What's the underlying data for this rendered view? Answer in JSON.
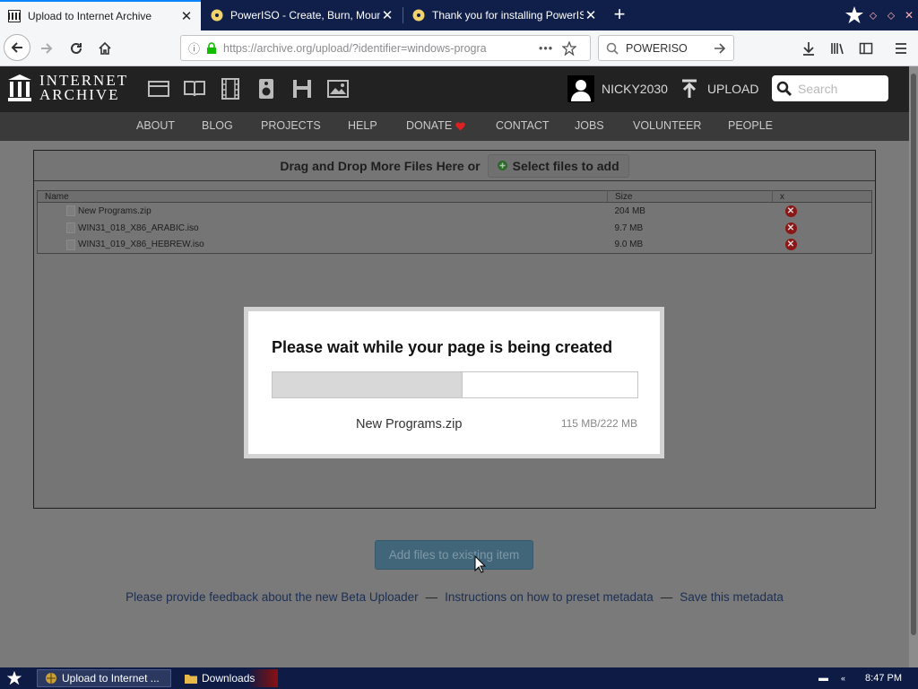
{
  "browser": {
    "tabs": [
      {
        "title": "Upload to Internet Archive",
        "active": true
      },
      {
        "title": "PowerISO - Create, Burn, Mount,",
        "active": false
      },
      {
        "title": "Thank you for installing PowerISO!",
        "active": false
      }
    ],
    "url": "https://archive.org/upload/?identifier=windows-progra",
    "search_value": "POWERISO"
  },
  "site": {
    "logo_line1": "INTERNET",
    "logo_line2": "ARCHIVE",
    "username": "NICKY2030",
    "upload_label": "UPLOAD",
    "search_placeholder": "Search",
    "nav": [
      "ABOUT",
      "BLOG",
      "PROJECTS",
      "HELP",
      "DONATE",
      "CONTACT",
      "JOBS",
      "VOLUNTEER",
      "PEOPLE"
    ]
  },
  "uploader": {
    "dropzone_text": "Drag and Drop More Files Here or",
    "select_label": "Select files to add",
    "columns": {
      "name": "Name",
      "size": "Size",
      "remove": "x"
    },
    "files": [
      {
        "name": "New Programs.zip",
        "size": "204 MB"
      },
      {
        "name": "WIN31_018_X86_ARABIC.iso",
        "size": "9.7 MB"
      },
      {
        "name": "WIN31_019_X86_HEBREW.iso",
        "size": "9.0 MB"
      }
    ],
    "add_button": "Add files to existing item"
  },
  "footer": {
    "feedback": "Please provide feedback about the new Beta Uploader",
    "instructions": "Instructions on how to preset metadata",
    "save": "Save this metadata",
    "separator": "—"
  },
  "modal": {
    "title": "Please wait while your page is being created",
    "filename": "New Programs.zip",
    "size_text": "115 MB/222 MB",
    "progress": 0.52
  },
  "taskbar": {
    "items": [
      "Upload to Internet ...",
      "Downloads"
    ],
    "clock": "8:47 PM"
  },
  "colors": {
    "chrome_dark": "#0f1f4a",
    "site_header": "#222222",
    "link": "#1c2f52",
    "remove_red": "#8b1616"
  }
}
